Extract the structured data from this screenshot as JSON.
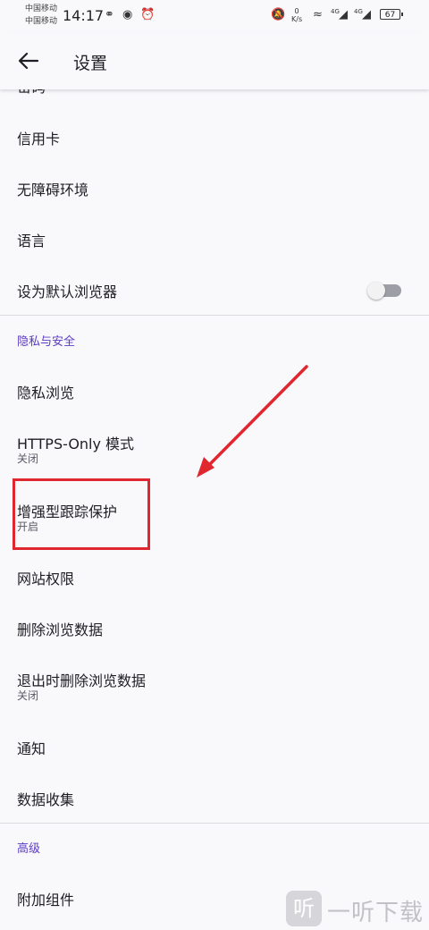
{
  "status_bar": {
    "carrier1": "中国移动",
    "carrier2": "中国移动",
    "time": "14:17",
    "net_speed_value": "0",
    "net_speed_unit": "K/s",
    "signal1": "4G",
    "signal2": "4G",
    "battery": "67"
  },
  "app_bar": {
    "title": "设置",
    "back_icon": "arrow-left-icon"
  },
  "list": {
    "partial_top": "密码",
    "items": [
      {
        "label": "信用卡"
      },
      {
        "label": "无障碍环境"
      },
      {
        "label": "语言"
      },
      {
        "label": "设为默认浏览器",
        "toggle": false
      }
    ],
    "privacy_section": "隐私与安全",
    "privacy_items": [
      {
        "label": "隐私浏览"
      },
      {
        "label": "HTTPS-Only 模式",
        "sub": "关闭"
      },
      {
        "label": "增强型跟踪保护",
        "sub": "开启"
      },
      {
        "label": "网站权限"
      },
      {
        "label": "删除浏览数据"
      },
      {
        "label": "退出时删除浏览数据",
        "sub": "关闭"
      },
      {
        "label": "通知"
      },
      {
        "label": "数据收集"
      }
    ],
    "advanced_section": "高级",
    "advanced_items": [
      {
        "label": "附加组件"
      }
    ]
  },
  "watermark": {
    "logo": "听",
    "text": "一听下载"
  },
  "colors": {
    "accent": "#5b3cc4",
    "annotation": "#e0262f",
    "background": "#f9f8fb"
  }
}
